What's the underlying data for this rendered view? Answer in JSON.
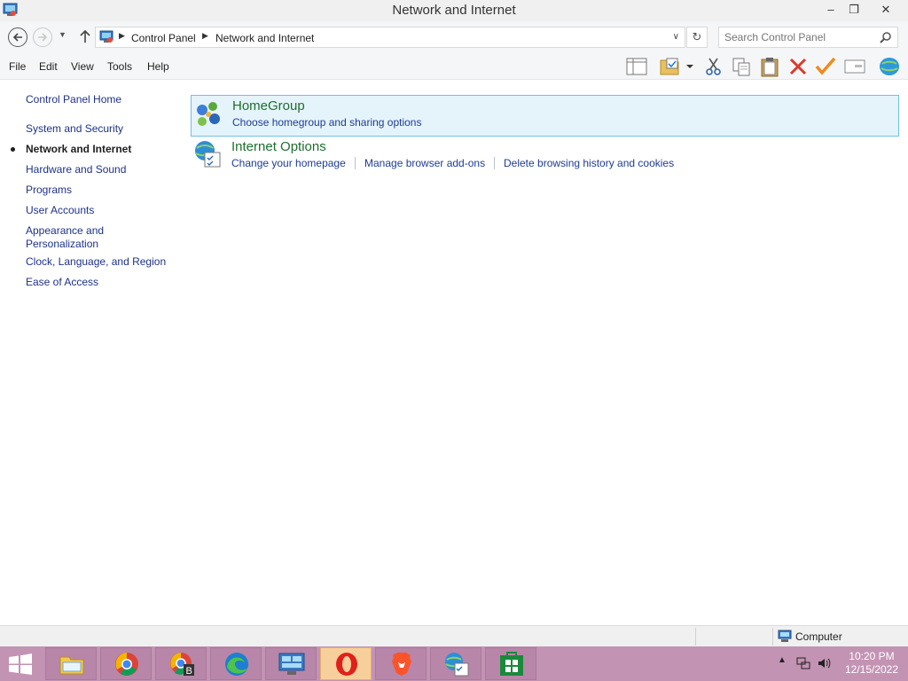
{
  "window": {
    "title": "Network and Internet",
    "minimize_glyph": "–",
    "maximize_glyph": "❐",
    "close_glyph": "✕"
  },
  "address_bar": {
    "breadcrumbs": [
      "Control Panel",
      "Network and Internet"
    ],
    "separator_glyph": "▶",
    "dropdown_glyph": "∨",
    "refresh_glyph": "↻",
    "recent_glyph": "▼"
  },
  "search": {
    "placeholder": "Search Control Panel"
  },
  "menu": {
    "items": [
      "File",
      "Edit",
      "View",
      "Tools",
      "Help"
    ]
  },
  "toolbar": {
    "icons": [
      "layout-icon",
      "folder-options-icon",
      "dropdown-icon",
      "cut-icon",
      "copy-icon",
      "paste-icon",
      "delete-icon",
      "checkmark-icon",
      "properties-icon",
      "network-globe-icon"
    ]
  },
  "leftnav": {
    "home": "Control Panel Home",
    "items": [
      "System and Security",
      "Network and Internet",
      "Hardware and Sound",
      "Programs",
      "User Accounts",
      "Appearance and Personalization",
      "Clock, Language, and Region",
      "Ease of Access"
    ],
    "current": "Network and Internet"
  },
  "categories": [
    {
      "title": "HomeGroup",
      "links": [
        "Choose homegroup and sharing options"
      ],
      "icon": "homegroup-icon"
    },
    {
      "title": "Internet Options",
      "links": [
        "Change your homepage",
        "Manage browser add-ons",
        "Delete browsing history and cookies"
      ],
      "icon": "internet-options-icon"
    }
  ],
  "statusbar": {
    "label": "Computer"
  },
  "taskbar": {
    "apps": [
      "file-explorer-icon",
      "chrome-icon",
      "chrome-beta-icon",
      "edge-icon",
      "remote-desktop-icon",
      "opera-icon",
      "brave-icon",
      "internet-options-icon",
      "store-icon"
    ],
    "active_app": "opera-icon",
    "tray_arrow": "▲",
    "clock_time": "10:20 PM",
    "clock_date": "12/15/2022"
  },
  "colors": {
    "taskbar": "#c393b4",
    "selected_category_bg": "#e5f3fb",
    "selected_category_border": "#70c0e7",
    "category_title": "#1e6e2e",
    "link": "#1e3c94"
  }
}
